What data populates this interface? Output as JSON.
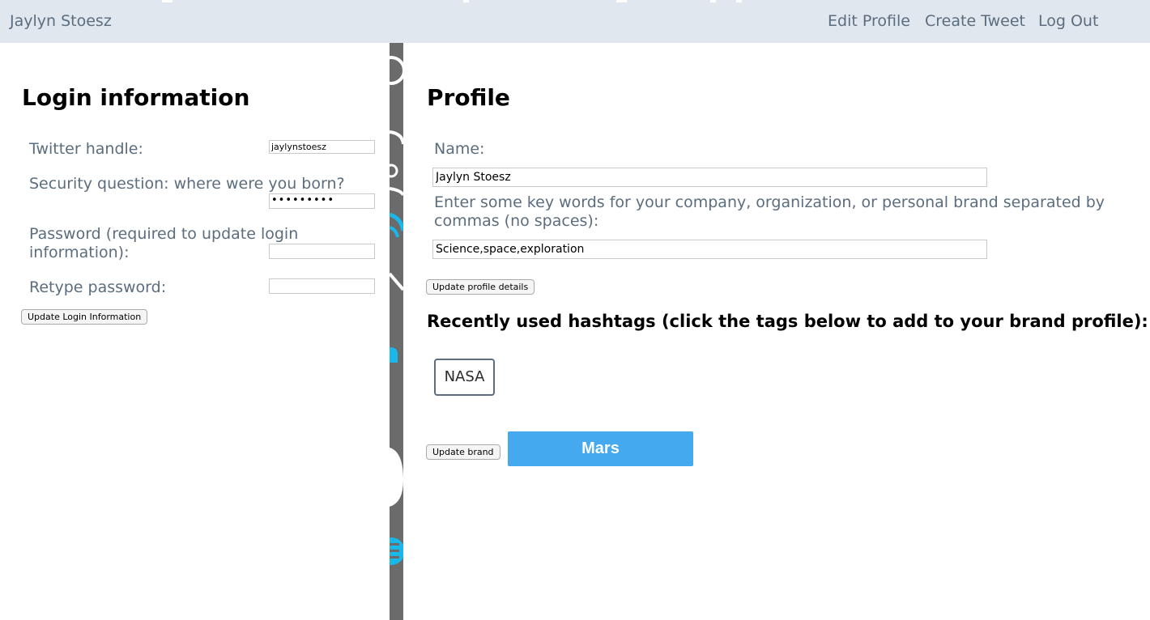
{
  "header": {
    "user_name": "Jaylyn Stoesz",
    "nav": {
      "edit_profile": "Edit Profile",
      "create_tweet": "Create Tweet",
      "log_out": "Log Out"
    }
  },
  "login": {
    "title": "Login information",
    "twitter_handle_label": "Twitter handle:",
    "twitter_handle_value": "jaylynstoesz",
    "security_question_label": "Security question: where were you born?",
    "security_answer_masked": "•••••••••",
    "password_label": "Password (required to update login information):",
    "password_value": "",
    "retype_password_label": "Retype password:",
    "retype_password_value": "",
    "update_button": "Update Login Information"
  },
  "profile": {
    "title": "Profile",
    "name_label": "Name:",
    "name_value": "Jaylyn Stoesz",
    "keywords_label": "Enter some key words for your company, organization, or personal brand separated by commas (no spaces):",
    "keywords_value": "Science,space,exploration",
    "update_details_button": "Update profile details",
    "hashtags_heading": "Recently used hashtags (click the tags below to add to your brand profile):",
    "hashtags": [
      "NASA"
    ],
    "update_brand_button": "Update brand",
    "brand_tag": "Mars"
  },
  "colors": {
    "topbar_bg": "#e1e7ee",
    "label_text": "#5b6d7e",
    "accent_button": "#44a9ee",
    "strip": "#6b6b6b",
    "strip_icons": "#1ab7ea"
  }
}
